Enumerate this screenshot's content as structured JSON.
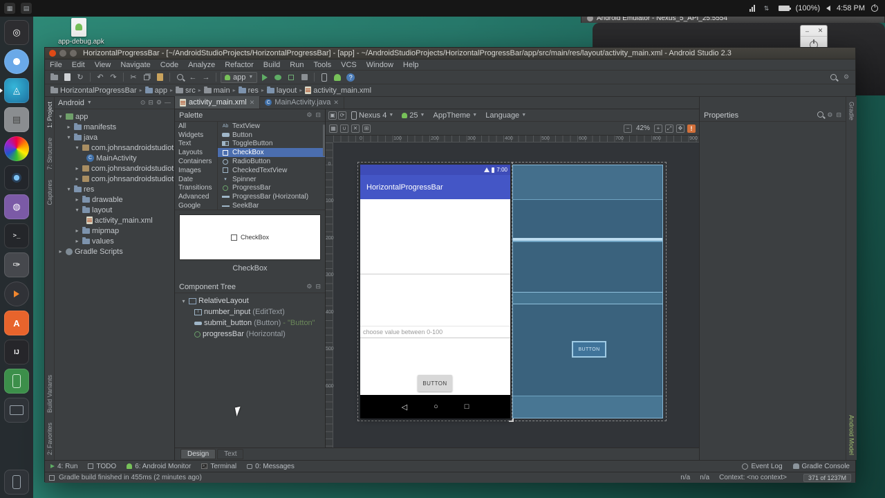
{
  "desktop": {
    "clock": "4:58 PM",
    "battery_label": "(100%)",
    "desktop_icon_label": "app-debug.apk",
    "launcher_items": [
      "dash-home",
      "chromium-browser",
      "android-studio",
      "file-manager",
      "media-disc",
      "camera-app",
      "graphics-app",
      "terminal",
      "image-editor",
      "media-player",
      "software-center",
      "intellij-idea",
      "android-phone",
      "tablet-device",
      "emulator-phone"
    ]
  },
  "emulator": {
    "title": "Android Emulator - Nexus_5_API_25:5554"
  },
  "studio": {
    "window_title": "HorizontalProgressBar - [~/AndroidStudioProjects/HorizontalProgressBar] - [app] - ~/AndroidStudioProjects/HorizontalProgressBar/app/src/main/res/layout/activity_main.xml - Android Studio 2.3",
    "menus": [
      "File",
      "Edit",
      "View",
      "Navigate",
      "Code",
      "Analyze",
      "Refactor",
      "Build",
      "Run",
      "Tools",
      "VCS",
      "Window",
      "Help"
    ],
    "toolbar": {
      "run_config": "app"
    },
    "breadcrumbs": [
      "HorizontalProgressBar",
      "app",
      "src",
      "main",
      "res",
      "layout",
      "activity_main.xml"
    ],
    "left_tabs": [
      "1: Project",
      "7: Structure",
      "Captures",
      "Build Variants",
      "2: Favorites"
    ],
    "right_tabs": [
      "Gradle",
      "Android Model"
    ],
    "project": {
      "view_selector": "Android",
      "tree": [
        {
          "label": "app"
        },
        {
          "label": "manifests"
        },
        {
          "label": "java"
        },
        {
          "label": "com.johnsandroidstudiot"
        },
        {
          "label": "MainActivity"
        },
        {
          "label": "com.johnsandroidstudiot"
        },
        {
          "label": "com.johnsandroidstudiot"
        },
        {
          "label": "res"
        },
        {
          "label": "drawable"
        },
        {
          "label": "layout"
        },
        {
          "label": "activity_main.xml"
        },
        {
          "label": "mipmap"
        },
        {
          "label": "values"
        },
        {
          "label": "Gradle Scripts"
        }
      ]
    },
    "editor_tabs": [
      "activity_main.xml",
      "MainActivity.java"
    ],
    "palette": {
      "title": "Palette",
      "categories": [
        "All",
        "Widgets",
        "Text",
        "Layouts",
        "Containers",
        "Images",
        "Date",
        "Transitions",
        "Advanced",
        "Google"
      ],
      "components": [
        "TextView",
        "Button",
        "ToggleButton",
        "CheckBox",
        "RadioButton",
        "CheckedTextView",
        "Spinner",
        "ProgressBar",
        "ProgressBar (Horizontal)",
        "SeekBar"
      ],
      "selected_component": "CheckBox",
      "preview_text": "CheckBox",
      "caption": "CheckBox"
    },
    "component_tree": {
      "title": "Component Tree",
      "items": [
        {
          "name": "RelativeLayout",
          "type": "",
          "suffix": ""
        },
        {
          "name": "number_input",
          "type": "(EditText)",
          "suffix": ""
        },
        {
          "name": "submit_button",
          "type": "(Button)",
          "suffix": "- \"Button\""
        },
        {
          "name": "progressBar",
          "type": "(Horizontal)",
          "suffix": ""
        }
      ]
    },
    "design": {
      "device": "Nexus 4",
      "api_level": "25",
      "theme": "AppTheme",
      "locale": "Language",
      "zoom": "42%",
      "ruler_top": [
        "0",
        "100",
        "200",
        "300",
        "400",
        "500",
        "600",
        "700",
        "800",
        "900"
      ],
      "ruler_left": [
        "0",
        "100",
        "200",
        "300",
        "400",
        "500",
        "600"
      ],
      "bottom_tabs": [
        "Design",
        "Text"
      ],
      "phone": {
        "status_time": "7:00",
        "app_title": "HorizontalProgressBar",
        "edit_hint": "choose value between 0-100",
        "button_label": "BUTTON"
      },
      "blueprint": {
        "button_label": "BUTTON"
      }
    },
    "properties": {
      "title": "Properties"
    },
    "bottom_bar": {
      "items": [
        "4: Run",
        "TODO",
        "6: Android Monitor",
        "Terminal",
        "0: Messages"
      ],
      "right_items": [
        "Event Log",
        "Gradle Console"
      ]
    },
    "status": {
      "message": "Gradle build finished in 455ms (2 minutes ago)",
      "na1": "n/a",
      "na2": "n/a",
      "context": "Context: <no context>",
      "memory": "371 of 1237M"
    }
  }
}
